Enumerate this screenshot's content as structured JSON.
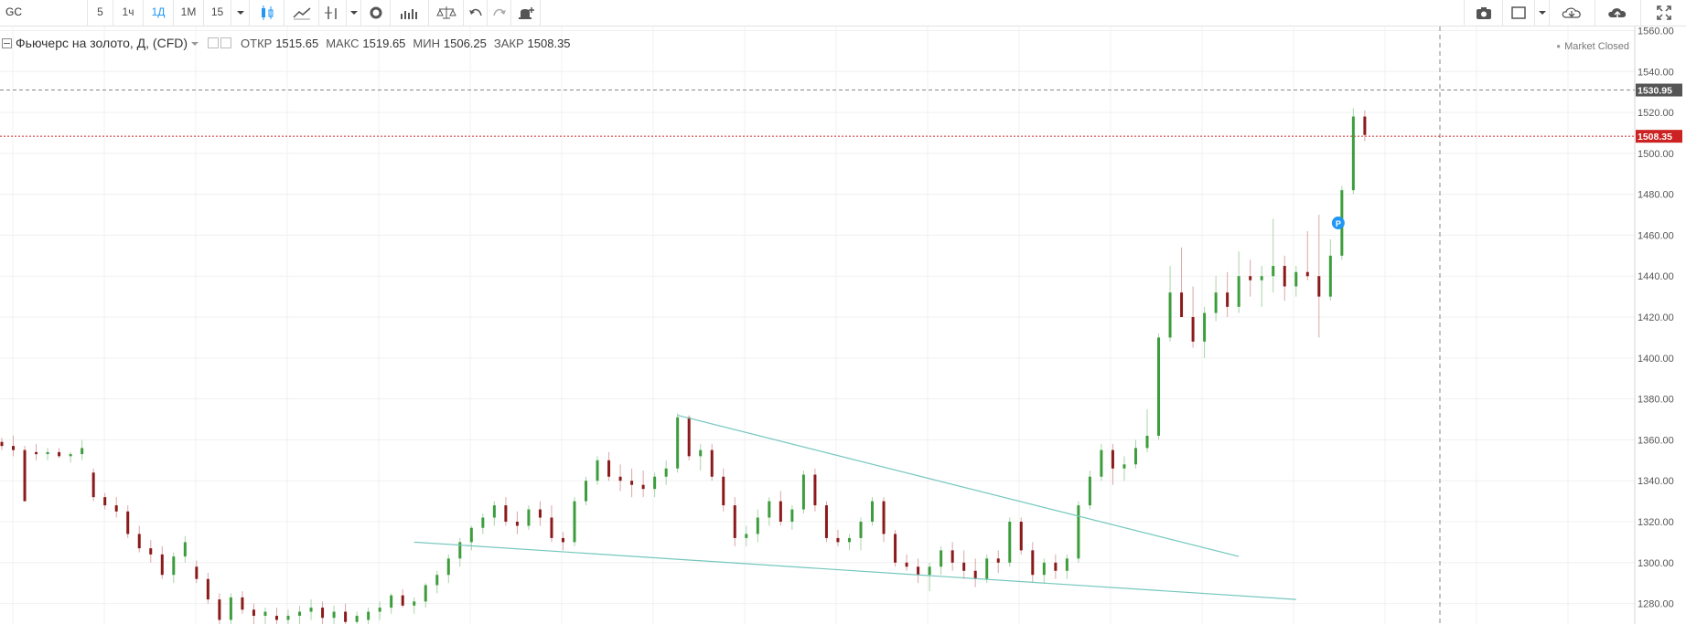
{
  "toolbar": {
    "symbol": "GC",
    "intervals": [
      "5",
      "1ч",
      "1Д",
      "1М",
      "15"
    ],
    "active_interval": "1Д",
    "buttons": [
      "candles-icon",
      "line-chart-icon",
      "indicators-icon",
      "settings-icon",
      "bars-icon",
      "compare-icon",
      "undo-icon",
      "redo-icon",
      "alert-icon",
      "camera-icon",
      "layout-icon",
      "cloud-download-icon",
      "cloud-upload-icon",
      "fullscreen-icon"
    ]
  },
  "legend": {
    "title": "Фьючерс на золото, Д, (CFD)",
    "open_label": "ОТКР",
    "open": "1515.65",
    "high_label": "МАКС",
    "high": "1519.65",
    "low_label": "МИН",
    "low": "1506.25",
    "close_label": "ЗАКР",
    "close": "1508.35"
  },
  "status": "Market Closed",
  "colors": {
    "up": "#3d9d3d",
    "down": "#8b1a1a",
    "trend": "#74c7bd",
    "price_line": "#cc2222",
    "crosshair": "#888888",
    "marker": "#2196f3"
  },
  "chart_data": {
    "type": "candlestick",
    "y_axis": {
      "min": 1270,
      "max": 1562,
      "ticks": [
        1280,
        1300,
        1320,
        1340,
        1360,
        1380,
        1400,
        1420,
        1440,
        1460,
        1480,
        1500,
        1520,
        1540,
        1560
      ],
      "tick_labels": [
        "1280.00",
        "1300.00",
        "1320.00",
        "1340.00",
        "1360.00",
        "1380.00",
        "1400.00",
        "1420.00",
        "1440.00",
        "1460.00",
        "1480.00",
        "1500.00",
        "1520.00",
        "1540.00",
        "1560.00"
      ]
    },
    "crosshair_price": "1530.95",
    "last_price": "1508.35",
    "marker_label": "P",
    "marker_price": 1466,
    "grid": true,
    "candles": [
      [
        1359,
        1361,
        1355,
        1357
      ],
      [
        1357,
        1362,
        1352,
        1355
      ],
      [
        1355,
        1357,
        1330,
        1330
      ],
      [
        1354,
        1358,
        1350,
        1353
      ],
      [
        1353,
        1356,
        1350,
        1354
      ],
      [
        1354,
        1356,
        1351,
        1352
      ],
      [
        1352,
        1354,
        1349,
        1353
      ],
      [
        1353,
        1360,
        1350,
        1356
      ],
      [
        1344,
        1346,
        1330,
        1332
      ],
      [
        1332,
        1334,
        1326,
        1328
      ],
      [
        1328,
        1332,
        1322,
        1325
      ],
      [
        1325,
        1328,
        1312,
        1314
      ],
      [
        1314,
        1318,
        1305,
        1307
      ],
      [
        1307,
        1311,
        1300,
        1304
      ],
      [
        1304,
        1308,
        1292,
        1294
      ],
      [
        1294,
        1305,
        1290,
        1303
      ],
      [
        1303,
        1313,
        1300,
        1310
      ],
      [
        1298,
        1301,
        1290,
        1292
      ],
      [
        1292,
        1295,
        1280,
        1282
      ],
      [
        1282,
        1285,
        1270,
        1272
      ],
      [
        1272,
        1285,
        1270,
        1283
      ],
      [
        1283,
        1286,
        1275,
        1277
      ],
      [
        1277,
        1280,
        1270,
        1274
      ],
      [
        1274,
        1278,
        1270,
        1276
      ],
      [
        1274,
        1278,
        1270,
        1272
      ],
      [
        1272,
        1277,
        1270,
        1274
      ],
      [
        1274,
        1279,
        1270,
        1276
      ],
      [
        1276,
        1282,
        1272,
        1278
      ],
      [
        1278,
        1281,
        1270,
        1273
      ],
      [
        1273,
        1279,
        1270,
        1276
      ],
      [
        1276,
        1280,
        1270,
        1271
      ],
      [
        1271,
        1276,
        1270,
        1274
      ],
      [
        1272,
        1278,
        1270,
        1276
      ],
      [
        1276,
        1281,
        1272,
        1278
      ],
      [
        1278,
        1285,
        1275,
        1284
      ],
      [
        1284,
        1287,
        1278,
        1279
      ],
      [
        1279,
        1283,
        1275,
        1281
      ],
      [
        1281,
        1290,
        1278,
        1289
      ],
      [
        1289,
        1296,
        1285,
        1294
      ],
      [
        1294,
        1304,
        1290,
        1302
      ],
      [
        1302,
        1312,
        1298,
        1310
      ],
      [
        1310,
        1318,
        1306,
        1317
      ],
      [
        1317,
        1324,
        1314,
        1322
      ],
      [
        1322,
        1330,
        1318,
        1328
      ],
      [
        1328,
        1332,
        1318,
        1320
      ],
      [
        1320,
        1325,
        1314,
        1318
      ],
      [
        1318,
        1328,
        1316,
        1326
      ],
      [
        1326,
        1330,
        1318,
        1322
      ],
      [
        1322,
        1328,
        1310,
        1312
      ],
      [
        1312,
        1315,
        1306,
        1310
      ],
      [
        1310,
        1332,
        1308,
        1330
      ],
      [
        1330,
        1342,
        1328,
        1340
      ],
      [
        1340,
        1352,
        1338,
        1350
      ],
      [
        1350,
        1354,
        1340,
        1342
      ],
      [
        1342,
        1348,
        1335,
        1340
      ],
      [
        1340,
        1346,
        1332,
        1338
      ],
      [
        1338,
        1345,
        1332,
        1336
      ],
      [
        1336,
        1344,
        1332,
        1342
      ],
      [
        1342,
        1350,
        1338,
        1346
      ],
      [
        1346,
        1373,
        1344,
        1371
      ],
      [
        1371,
        1372,
        1350,
        1352
      ],
      [
        1352,
        1358,
        1345,
        1355
      ],
      [
        1355,
        1358,
        1340,
        1342
      ],
      [
        1342,
        1346,
        1325,
        1328
      ],
      [
        1328,
        1332,
        1308,
        1312
      ],
      [
        1312,
        1318,
        1308,
        1314
      ],
      [
        1314,
        1326,
        1310,
        1322
      ],
      [
        1322,
        1332,
        1318,
        1330
      ],
      [
        1330,
        1335,
        1318,
        1320
      ],
      [
        1320,
        1328,
        1316,
        1326
      ],
      [
        1326,
        1345,
        1324,
        1343
      ],
      [
        1343,
        1346,
        1325,
        1328
      ],
      [
        1328,
        1330,
        1310,
        1312
      ],
      [
        1312,
        1316,
        1308,
        1310
      ],
      [
        1310,
        1314,
        1306,
        1312
      ],
      [
        1312,
        1322,
        1306,
        1320
      ],
      [
        1320,
        1332,
        1318,
        1330
      ],
      [
        1330,
        1332,
        1310,
        1314
      ],
      [
        1314,
        1316,
        1298,
        1300
      ],
      [
        1300,
        1304,
        1296,
        1298
      ],
      [
        1298,
        1302,
        1290,
        1294
      ],
      [
        1294,
        1300,
        1286,
        1298
      ],
      [
        1298,
        1308,
        1294,
        1306
      ],
      [
        1306,
        1310,
        1296,
        1300
      ],
      [
        1300,
        1306,
        1292,
        1296
      ],
      [
        1296,
        1302,
        1288,
        1292
      ],
      [
        1292,
        1304,
        1290,
        1302
      ],
      [
        1302,
        1306,
        1295,
        1300
      ],
      [
        1300,
        1322,
        1298,
        1320
      ],
      [
        1320,
        1322,
        1304,
        1306
      ],
      [
        1306,
        1310,
        1290,
        1294
      ],
      [
        1294,
        1302,
        1290,
        1300
      ],
      [
        1300,
        1304,
        1292,
        1296
      ],
      [
        1296,
        1304,
        1292,
        1302
      ],
      [
        1302,
        1330,
        1300,
        1328
      ],
      [
        1328,
        1345,
        1326,
        1342
      ],
      [
        1342,
        1358,
        1340,
        1355
      ],
      [
        1355,
        1358,
        1338,
        1346
      ],
      [
        1346,
        1352,
        1340,
        1348
      ],
      [
        1348,
        1360,
        1346,
        1356
      ],
      [
        1356,
        1375,
        1354,
        1362
      ],
      [
        1362,
        1412,
        1360,
        1410
      ],
      [
        1410,
        1445,
        1408,
        1432
      ],
      [
        1432,
        1454,
        1425,
        1420
      ],
      [
        1420,
        1435,
        1405,
        1408
      ],
      [
        1408,
        1425,
        1400,
        1422
      ],
      [
        1422,
        1440,
        1418,
        1432
      ],
      [
        1432,
        1442,
        1420,
        1425
      ],
      [
        1425,
        1452,
        1422,
        1440
      ],
      [
        1440,
        1448,
        1430,
        1438
      ],
      [
        1438,
        1445,
        1425,
        1440
      ],
      [
        1440,
        1468,
        1432,
        1445
      ],
      [
        1445,
        1450,
        1428,
        1435
      ],
      [
        1435,
        1445,
        1430,
        1442
      ],
      [
        1442,
        1462,
        1438,
        1440
      ],
      [
        1440,
        1470,
        1410,
        1430
      ],
      [
        1430,
        1458,
        1428,
        1450
      ],
      [
        1450,
        1484,
        1448,
        1482
      ],
      [
        1482,
        1522,
        1480,
        1518
      ],
      [
        1518,
        1521,
        1506,
        1509
      ]
    ],
    "trendlines": [
      {
        "from": [
          59,
          1372
        ],
        "to": [
          108,
          1303
        ]
      },
      {
        "from": [
          36,
          1310
        ],
        "to": [
          113,
          1282
        ]
      }
    ]
  }
}
